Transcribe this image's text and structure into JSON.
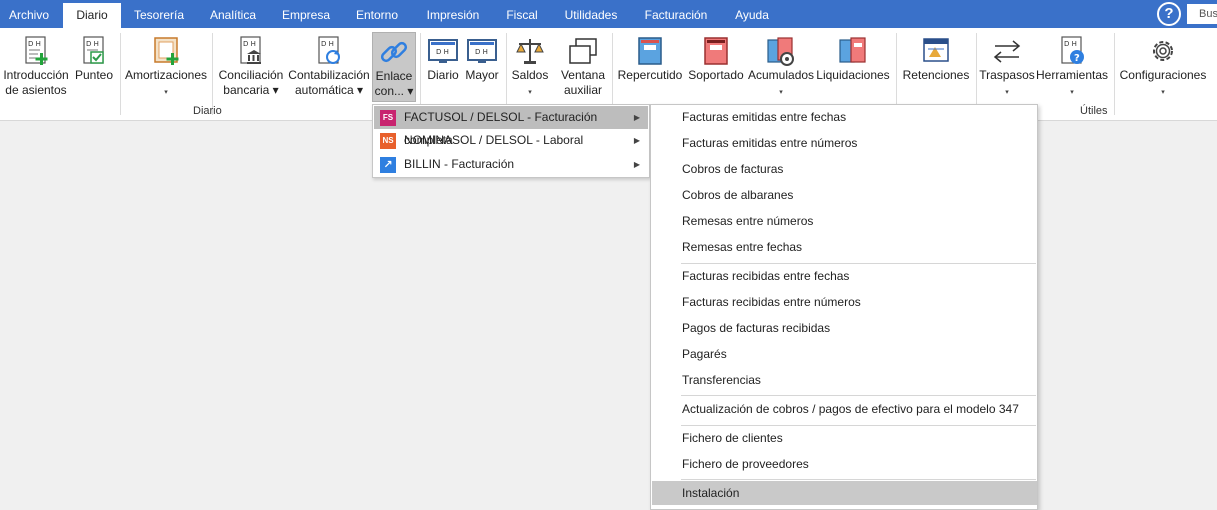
{
  "tabs": [
    {
      "label": "Archivo"
    },
    {
      "label": "Diario",
      "active": true
    },
    {
      "label": "Tesorería"
    },
    {
      "label": "Analítica"
    },
    {
      "label": "Empresa"
    },
    {
      "label": "Entorno"
    },
    {
      "label": "Impresión"
    },
    {
      "label": "Fiscal"
    },
    {
      "label": "Utilidades"
    },
    {
      "label": "Facturación"
    },
    {
      "label": "Ayuda"
    }
  ],
  "help": {
    "symbol": "?"
  },
  "search": {
    "text": "Bus"
  },
  "ribbon": {
    "buttons": [
      {
        "line1": "Introducción",
        "line2": "de asientos",
        "icon": "doc-dh-plus-icon"
      },
      {
        "line1": "Punteo",
        "line2": "",
        "icon": "doc-dh-check-icon"
      },
      {
        "line1": "Amortizaciones",
        "line2": "▾",
        "icon": "frame-plus-icon"
      },
      {
        "line1": "Conciliación",
        "line2": "bancaria ▾",
        "icon": "doc-bank-icon"
      },
      {
        "line1": "Contabilización",
        "line2": "automática ▾",
        "icon": "doc-refresh-icon"
      },
      {
        "line1": "Enlace",
        "line2": "con... ▾",
        "icon": "link-icon"
      },
      {
        "line1": "Diario",
        "line2": "",
        "icon": "monitor-dh-icon"
      },
      {
        "line1": "Mayor",
        "line2": "",
        "icon": "monitor-dh-icon"
      },
      {
        "line1": "Saldos",
        "line2": "▾",
        "icon": "balance-scale-icon"
      },
      {
        "line1": "Ventana",
        "line2": "auxiliar",
        "icon": "windows-icon"
      },
      {
        "line1": "Repercutido",
        "line2": "",
        "icon": "book-blue-icon"
      },
      {
        "line1": "Soportado",
        "line2": "",
        "icon": "book-red-icon"
      },
      {
        "line1": "Acumulados",
        "line2": "▾",
        "icon": "books-gear-icon"
      },
      {
        "line1": "Liquidaciones",
        "line2": "",
        "icon": "books-icon"
      },
      {
        "line1": "Retenciones",
        "line2": "",
        "icon": "retenciones-icon"
      },
      {
        "line1": "Traspasos",
        "line2": "▾",
        "icon": "arrows-swap-icon"
      },
      {
        "line1": "Herramientas",
        "line2": "▾",
        "icon": "doc-help-icon"
      },
      {
        "line1": "Configuraciones",
        "line2": "▾",
        "icon": "gear-icon"
      }
    ],
    "groups": {
      "diario": "Diario",
      "utiles": "Útiles"
    }
  },
  "enlace_menu": [
    {
      "label": "FACTUSOL / DELSOL - Facturación completa",
      "badge": "FS",
      "badge_color": "#c8236f",
      "highlighted": true
    },
    {
      "label": "NOMINASOL / DELSOL - Laboral",
      "badge": "NS",
      "badge_color": "#e8602c"
    },
    {
      "label": "BILLIN - Facturación",
      "badge": "↗",
      "badge_color": "#2f7fe0"
    }
  ],
  "factusol_menu": [
    {
      "label": "Facturas emitidas entre fechas"
    },
    {
      "label": "Facturas emitidas entre números"
    },
    {
      "label": "Cobros de facturas"
    },
    {
      "label": "Cobros de albaranes"
    },
    {
      "label": "Remesas entre números"
    },
    {
      "label": "Remesas entre fechas"
    },
    {
      "label": "Facturas recibidas entre fechas"
    },
    {
      "label": "Facturas recibidas entre números"
    },
    {
      "label": "Pagos de facturas recibidas"
    },
    {
      "label": "Pagarés"
    },
    {
      "label": "Transferencias"
    },
    {
      "label": "Actualización de cobros / pagos de efectivo para el modelo 347"
    },
    {
      "label": "Fichero de clientes"
    },
    {
      "label": "Fichero de proveedores"
    },
    {
      "label": "Instalación",
      "highlighted": true
    }
  ],
  "colors": {
    "tab_bar": "#3a71c9",
    "pressed": "#c8c8c8",
    "highlight": "#bdbdbd"
  }
}
